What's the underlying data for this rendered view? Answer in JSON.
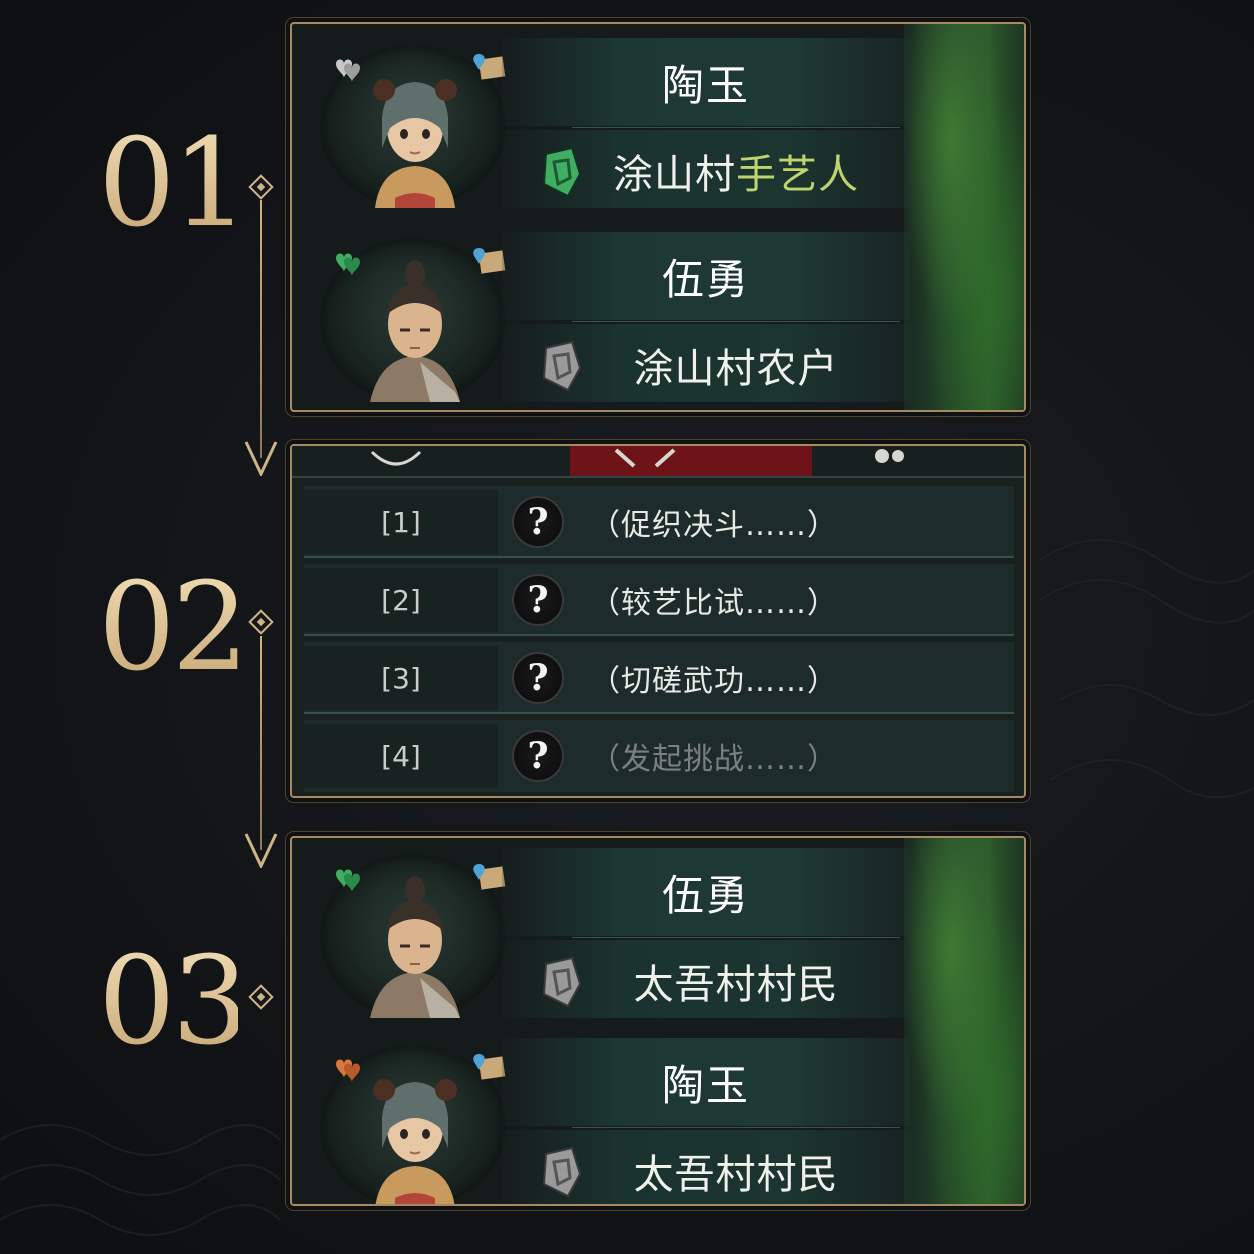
{
  "steps": [
    {
      "number": "01"
    },
    {
      "number": "02"
    },
    {
      "number": "03"
    }
  ],
  "panel1": {
    "characters": [
      {
        "name": "陶玉",
        "title_prefix": "涂山村",
        "title_highlight": "手艺人",
        "heart_color": "#c8c8c8",
        "badge_color": "#3fae63"
      },
      {
        "name": "伍勇",
        "title_prefix": "涂山村农户",
        "title_highlight": "",
        "heart_color": "#3fae63",
        "badge_color": "#9a9a9a"
      }
    ]
  },
  "panel2": {
    "options": [
      {
        "index": "[1]",
        "icon": "?",
        "text": "（促织决斗……）",
        "enabled": true
      },
      {
        "index": "[2]",
        "icon": "?",
        "text": "（较艺比试……）",
        "enabled": true
      },
      {
        "index": "[3]",
        "icon": "?",
        "text": "（切磋武功……）",
        "enabled": true
      },
      {
        "index": "[4]",
        "icon": "?",
        "text": "（发起挑战……）",
        "enabled": false
      }
    ]
  },
  "panel3": {
    "characters": [
      {
        "name": "伍勇",
        "title_prefix": "太吾村村民",
        "title_highlight": "",
        "heart_color": "#3fae63",
        "badge_color": "#9a9a9a"
      },
      {
        "name": "陶玉",
        "title_prefix": "太吾村村民",
        "title_highlight": "",
        "heart_color": "#d9783b",
        "badge_color": "#9a9a9a"
      }
    ]
  },
  "colors": {
    "accent_gold": "#cfb488",
    "panel_border": "#a58a62",
    "title_highlight": "#bfd36e",
    "disabled_text": "#7b817e"
  }
}
